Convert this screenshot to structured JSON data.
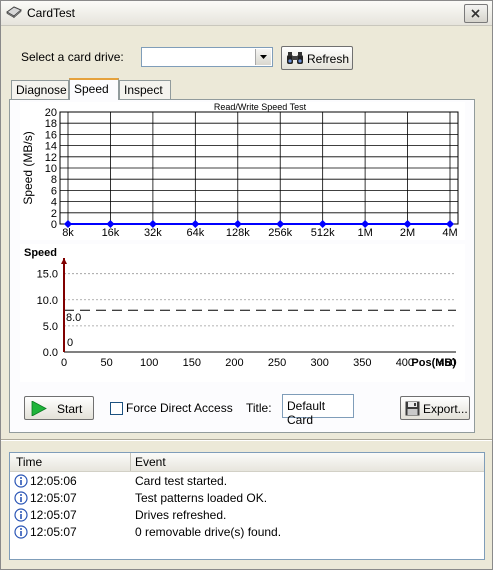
{
  "window": {
    "title": "CardTest",
    "accent": "#e6a23c"
  },
  "icons": {
    "app": "card-drive-icon",
    "close": "close-icon",
    "refresh": "binoculars-icon",
    "start": "play-icon",
    "export": "floppy-disk-icon",
    "log": "info-icon",
    "dropdown": "chevron-down-icon"
  },
  "drive": {
    "label": "Select a card drive:",
    "selected": "",
    "refresh_label": "Refresh"
  },
  "tabs": [
    {
      "label": "Diagnose"
    },
    {
      "label": "Speed"
    },
    {
      "label": "Inspect"
    }
  ],
  "active_tab": "Speed",
  "controls": {
    "start_label": "Start",
    "force_direct_access_label": "Force Direct Access",
    "force_direct_access_checked": false,
    "title_label": "Title:",
    "title_value": "Default Card",
    "export_label": "Export..."
  },
  "log": {
    "columns": [
      "Time",
      "Event"
    ],
    "rows": [
      {
        "time": "12:05:06",
        "event": "Card test started."
      },
      {
        "time": "12:05:07",
        "event": "Test patterns loaded OK."
      },
      {
        "time": "12:05:07",
        "event": "Drives refreshed."
      },
      {
        "time": "12:05:07",
        "event": "0 removable drive(s) found."
      }
    ]
  },
  "chart_data": [
    {
      "type": "line",
      "title": "Read/Write Speed Test",
      "ylabel": "Speed (MB/s)",
      "xlabel": "",
      "categories": [
        "8k",
        "16k",
        "32k",
        "64k",
        "128k",
        "256k",
        "512k",
        "1M",
        "2M",
        "4M"
      ],
      "y_ticks": [
        0,
        2,
        4,
        6,
        8,
        10,
        12,
        14,
        16,
        18,
        20
      ],
      "ylim": [
        0,
        20
      ],
      "grid": true,
      "series": [
        {
          "values": [
            0,
            0,
            0,
            0,
            0,
            0,
            0,
            0,
            0,
            0
          ],
          "color": "#0000ff"
        }
      ]
    },
    {
      "type": "line",
      "ylabel": "Speed",
      "xlabel": "Pos(MB)",
      "x_ticks": [
        0,
        50,
        100,
        150,
        200,
        250,
        300,
        350,
        400,
        450
      ],
      "y_ticks": [
        0.0,
        5.0,
        10.0,
        15.0
      ],
      "y_tick_labels": [
        "0.0",
        "5.0",
        "10.0",
        "15.0"
      ],
      "xlim": [
        0,
        460
      ],
      "ylim": [
        0,
        18
      ],
      "grid": "dotted-horizontal",
      "reference_line": {
        "y": 8.0,
        "label": "8.0",
        "style": "dashed"
      },
      "marker_label": "0",
      "series": [
        {
          "x": [
            0
          ],
          "y": [
            0
          ],
          "color": "#800000"
        }
      ]
    }
  ]
}
